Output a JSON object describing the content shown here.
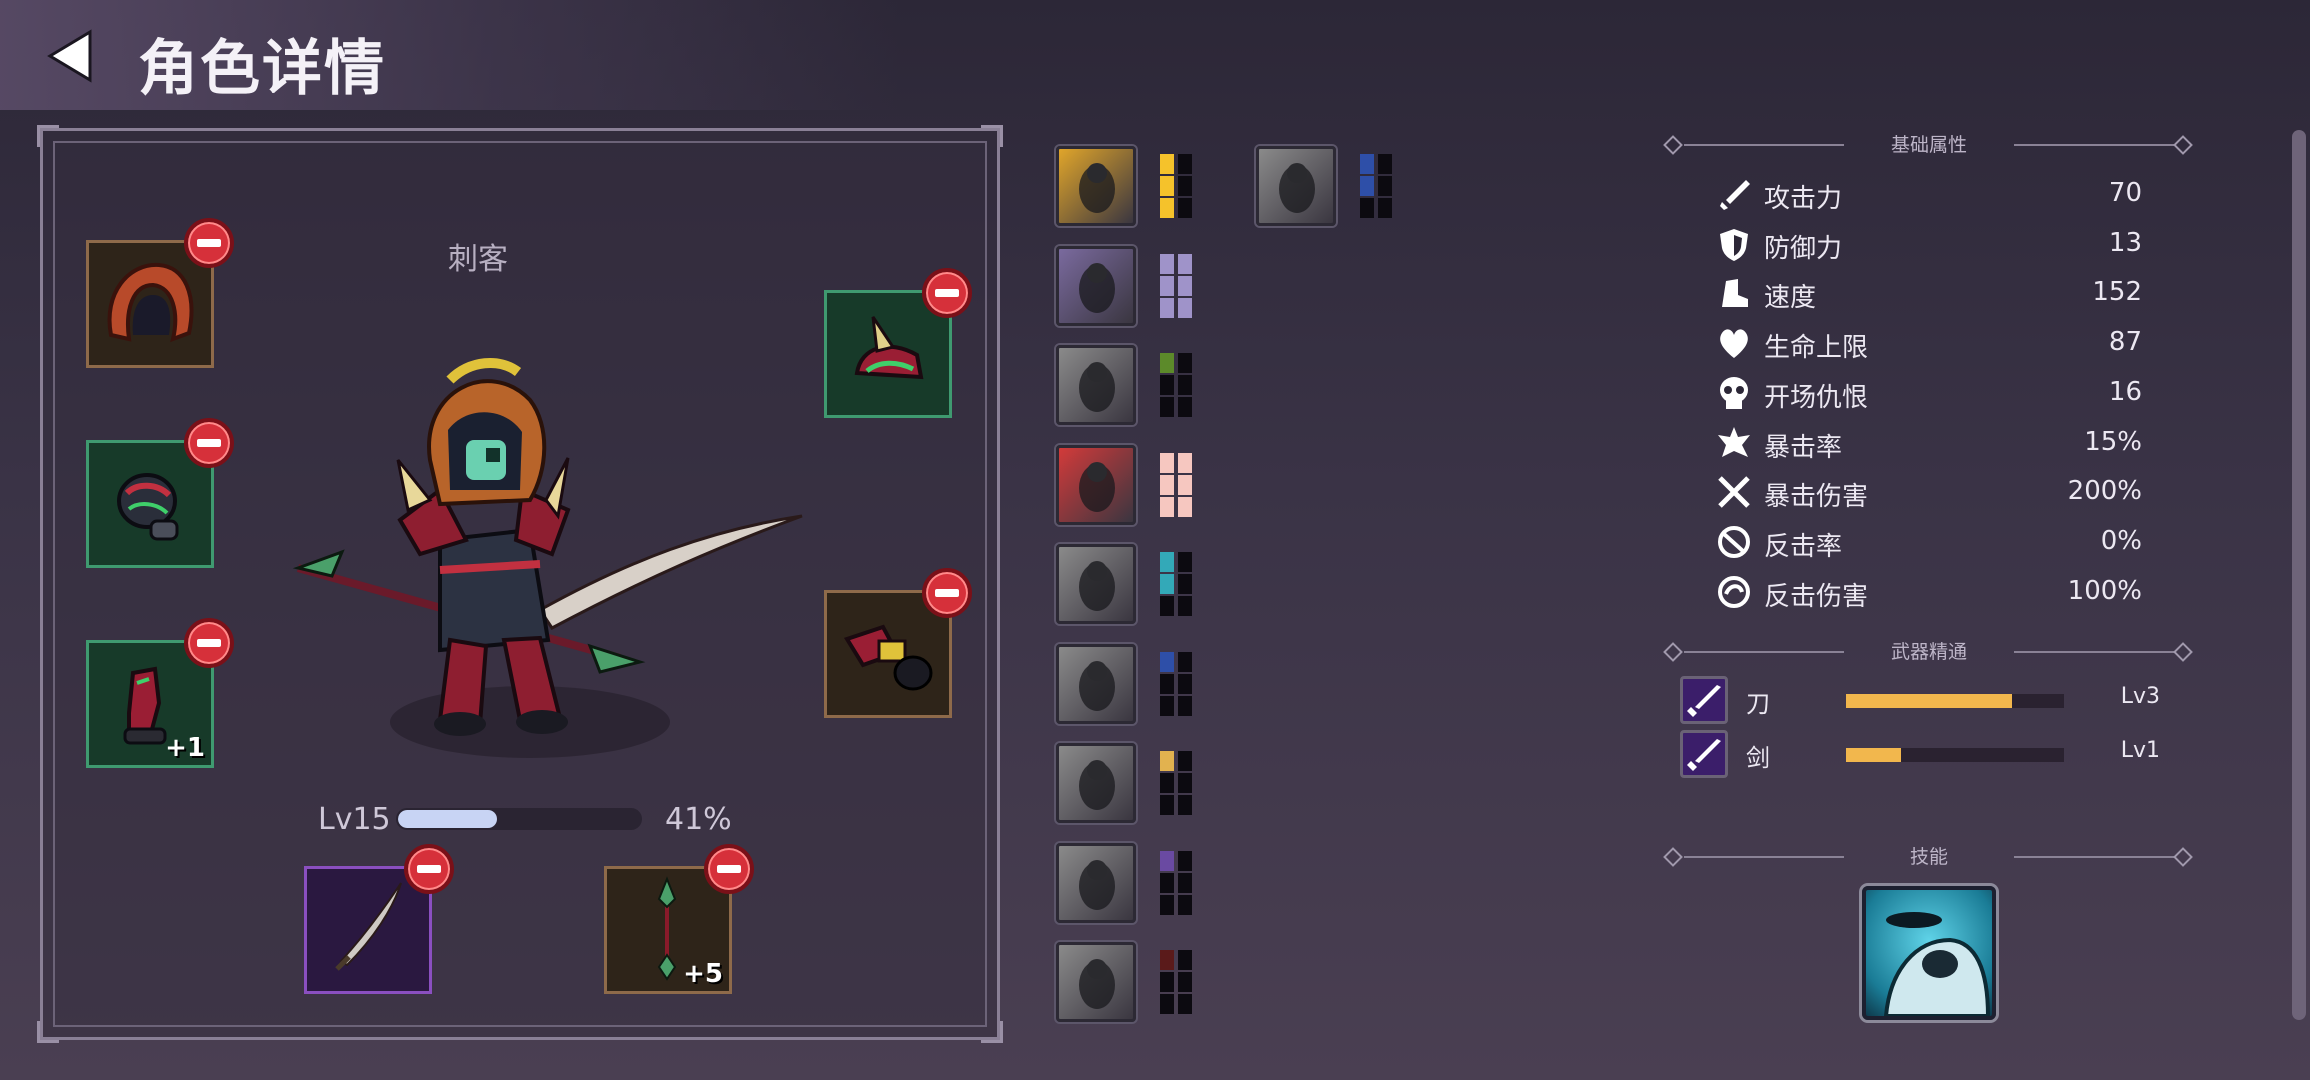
{
  "header": {
    "title": "角色详情",
    "back_icon": "back-arrow-icon"
  },
  "character": {
    "class_name": "刺客",
    "level_label": "Lv15",
    "exp_percent_label": "41%",
    "exp_progress": 0.41
  },
  "equipment": {
    "left": [
      {
        "name": "helmet",
        "rarity": "brown",
        "bonus": ""
      },
      {
        "name": "armor",
        "rarity": "green",
        "bonus": ""
      },
      {
        "name": "boots",
        "rarity": "green",
        "bonus": "+1"
      }
    ],
    "right": [
      {
        "name": "shoulder",
        "rarity": "green",
        "bonus": ""
      },
      {
        "name": "gloves",
        "rarity": "brown",
        "bonus": ""
      }
    ],
    "weapons": [
      {
        "name": "sword",
        "rarity": "purple",
        "bonus": ""
      },
      {
        "name": "spear",
        "rarity": "brown",
        "bonus": "+5"
      }
    ]
  },
  "traits": [
    {
      "color": "#f5c22b",
      "filled": 3,
      "bg": "#e0a52a"
    },
    {
      "color": "#9f93c9",
      "filled": 6,
      "bg": "#7a6a9e"
    },
    {
      "color": "#5c8a2a",
      "filled": 1,
      "bg": "#8a8a8a"
    },
    {
      "color": "#f6c7c0",
      "filled": 6,
      "bg": "#d23a3a"
    },
    {
      "color": "#33a9b8",
      "filled": 2,
      "bg": "#8a8a8a"
    },
    {
      "color": "#2e4fa8",
      "filled": 1,
      "bg": "#8a8a8a"
    },
    {
      "color": "#e2b24f",
      "filled": 1,
      "bg": "#8a8a8a"
    },
    {
      "color": "#6a4aa2",
      "filled": 1,
      "bg": "#8a8a8a"
    },
    {
      "color": "#5a1a1a",
      "filled": 1,
      "bg": "#8a8a8a"
    },
    {
      "color": "#2e4fa8",
      "filled": 2,
      "bg": "#8a8a8a"
    }
  ],
  "stats": {
    "section_title": "基础属性",
    "items": [
      {
        "label": "攻击力",
        "value": "70",
        "icon": "sword-icon"
      },
      {
        "label": "防御力",
        "value": "13",
        "icon": "shield-icon"
      },
      {
        "label": "速度",
        "value": "152",
        "icon": "boot-icon"
      },
      {
        "label": "生命上限",
        "value": "87",
        "icon": "heart-icon"
      },
      {
        "label": "开场仇恨",
        "value": "16",
        "icon": "skull-icon"
      },
      {
        "label": "暴击率",
        "value": "15%",
        "icon": "burst-icon"
      },
      {
        "label": "暴击伤害",
        "value": "200%",
        "icon": "crossed-swords-icon"
      },
      {
        "label": "反击率",
        "value": "0%",
        "icon": "counter-icon"
      },
      {
        "label": "反击伤害",
        "value": "100%",
        "icon": "swirl-icon"
      }
    ]
  },
  "mastery": {
    "section_title": "武器精通",
    "items": [
      {
        "label": "刀",
        "level": "Lv3",
        "progress": 0.76
      },
      {
        "label": "剑",
        "level": "Lv1",
        "progress": 0.25
      }
    ]
  },
  "skills": {
    "section_title": "技能"
  }
}
